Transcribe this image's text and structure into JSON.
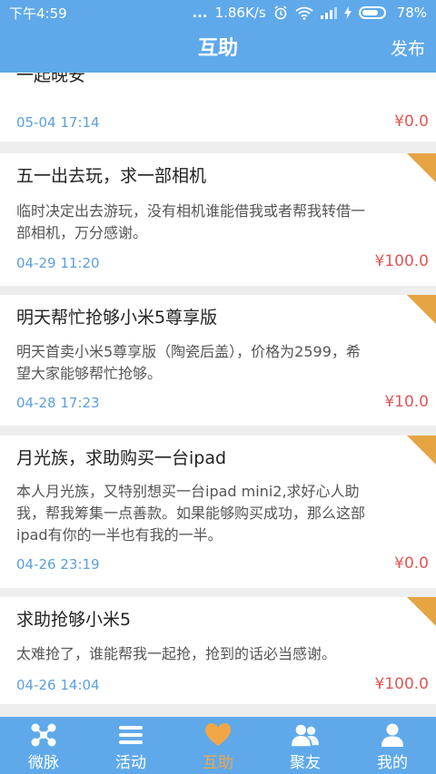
{
  "status": {
    "time": "下午4:59",
    "dots": "...",
    "speed": "1.86K/s",
    "battery": "78%",
    "battery_level": 0.78
  },
  "header": {
    "title": "互助",
    "publish_label": "发布"
  },
  "partial_item": {
    "title": "一起晚安",
    "date": "05-04 17:14",
    "price": "¥0.0"
  },
  "items": [
    {
      "title": "五一出去玩，求一部相机",
      "desc_lines": [
        "临时决定出去游玩，没有相机谁能借我或者帮我转借一",
        "部相机，万分感谢。"
      ],
      "date": "04-29 11:20",
      "price": "¥100.0"
    },
    {
      "title": "明天帮忙抢够小米5尊享版",
      "desc_lines": [
        "明天首卖小米5尊享版（陶瓷后盖），价格为2599，希",
        "望大家能够帮忙抢够。"
      ],
      "date": "04-28 17:23",
      "price": "¥10.0"
    },
    {
      "title": "月光族，求助购买一台ipad",
      "desc_lines": [
        "本人月光族，又特别想买一台ipad mini2,求好心人助",
        "我，帮我筹集一点善款。如果能够购买成功，那么这部",
        "ipad有你的一半也有我的一半。"
      ],
      "date": "04-26 23:19",
      "price": "¥0.0"
    },
    {
      "title": "求助抢够小米5",
      "desc_lines": [
        "太难抢了，谁能帮我一起抢，抢到的话必当感谢。"
      ],
      "date": "04-26 14:04",
      "price": "¥100.0"
    }
  ],
  "tabs": [
    {
      "label": "微脉",
      "icon": "network-icon"
    },
    {
      "label": "活动",
      "icon": "list-icon"
    },
    {
      "label": "互助",
      "icon": "heart-icon",
      "active": true
    },
    {
      "label": "聚友",
      "icon": "friends-icon"
    },
    {
      "label": "我的",
      "icon": "person-icon"
    }
  ],
  "colors": {
    "primary": "#5fa9ea",
    "price": "#e05656",
    "date": "#5b9fe0",
    "corner": "#e6a443",
    "active_tab": "#f2a646"
  }
}
